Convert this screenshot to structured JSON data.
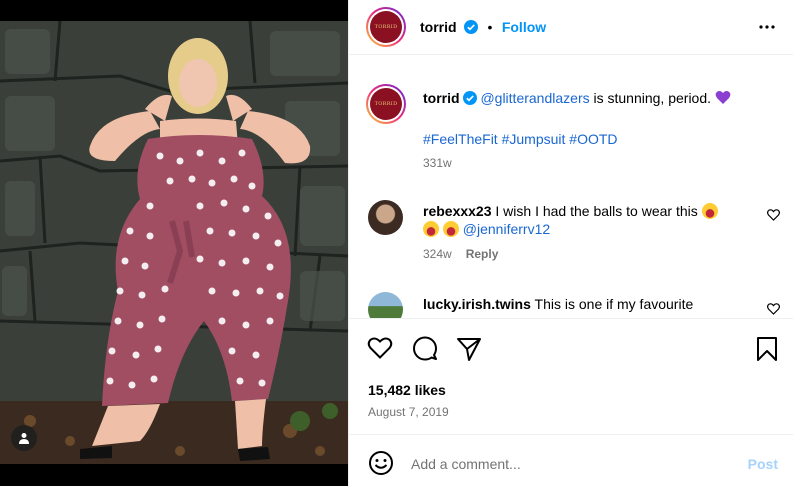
{
  "post": {
    "account": "torrid",
    "avatar_text": "TORRID",
    "follow_label": "Follow",
    "separator": "•",
    "caption": {
      "username": "torrid",
      "mention": "@glitterandlazers",
      "text": " is stunning, period. ",
      "hashtags": "#FeelTheFit #Jumpsuit #OOTD",
      "age": "331w"
    },
    "comments": [
      {
        "username": "rebexxx23",
        "text": " I wish I had the balls to wear this ",
        "mention": "@jenniferrv12",
        "age": "324w",
        "reply_label": "Reply"
      },
      {
        "username": "lucky.irish.twins",
        "text": " This is one if my favourite"
      }
    ],
    "likes": "15,482 likes",
    "date": "August 7, 2019",
    "comment_placeholder": "Add a comment...",
    "post_label": "Post"
  },
  "colors": {
    "brand_blue": "#0095f6",
    "post_disabled": "#a5d3fb",
    "jumpsuit": "#a14e63",
    "heart_emoji": "#8a3fd1"
  },
  "icons": [
    "verified-icon",
    "more-options-icon",
    "heart-icon",
    "comment-icon",
    "share-icon",
    "save-icon",
    "emoji-icon",
    "user-tag-icon"
  ]
}
